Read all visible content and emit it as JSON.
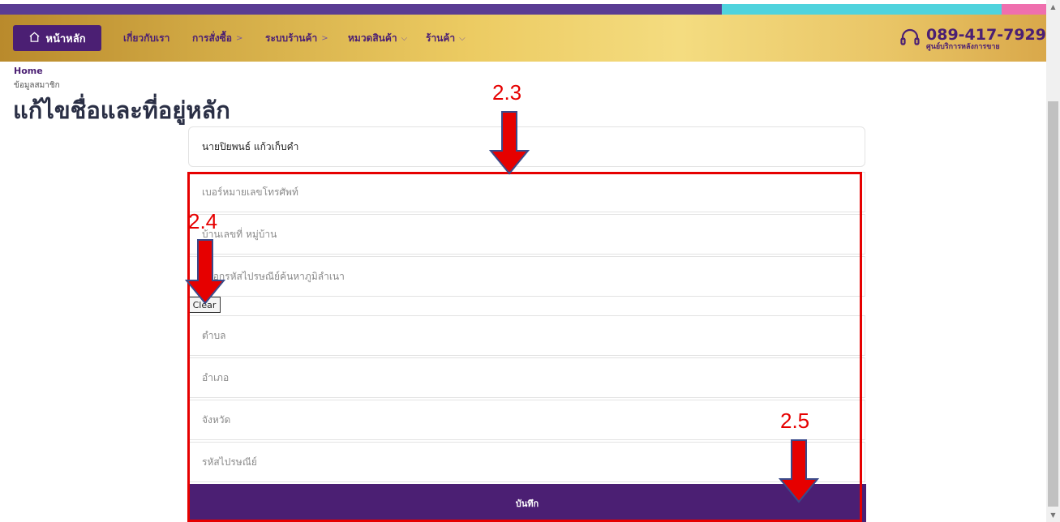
{
  "colors": {
    "brand": "#4b1f73",
    "annotation": "#e60000"
  },
  "nav": {
    "home_label": "หน้าหลัก",
    "items": [
      {
        "label": "เกี่ยวกับเรา",
        "chevron": ""
      },
      {
        "label": "การสั่งซื้อ",
        "chevron": ">"
      },
      {
        "label": "ระบบร้านค้า",
        "chevron": ">"
      },
      {
        "label": "หมวดสินค้า",
        "chevron": "⌵"
      },
      {
        "label": "ร้านค้า",
        "chevron": "⌵"
      }
    ],
    "phone": "089-417-7929",
    "phone_sub": "ศูนย์บริการหลังการขาย",
    "icons": {
      "home": "home-icon",
      "support": "headset-icon"
    }
  },
  "breadcrumb": {
    "home": "Home",
    "section": "ข้อมูลสมาชิก"
  },
  "page_title": "แก้ไขชื่อและที่อยู่หลัก",
  "form": {
    "name_value": "นายปิยพนธ์ แก้วเก็บคำ",
    "phone_placeholder": "เบอร์หมายเลขโทรศัพท์",
    "address_placeholder": "บ้านเลขที่ หมู่บ้าน",
    "postcode_search_placeholder": "กรอกรหัสไปรษณีย์ค้นหาภูมิลำเนา",
    "clear_label": "Clear",
    "subdistrict_placeholder": "ตำบล",
    "district_placeholder": "อำเภอ",
    "province_placeholder": "จังหวัด",
    "postcode_placeholder": "รหัสไปรษณีย์",
    "save_label": "บันทึก"
  },
  "annotations": {
    "a1": "2.3",
    "a2": "2.4",
    "a3": "2.5"
  }
}
